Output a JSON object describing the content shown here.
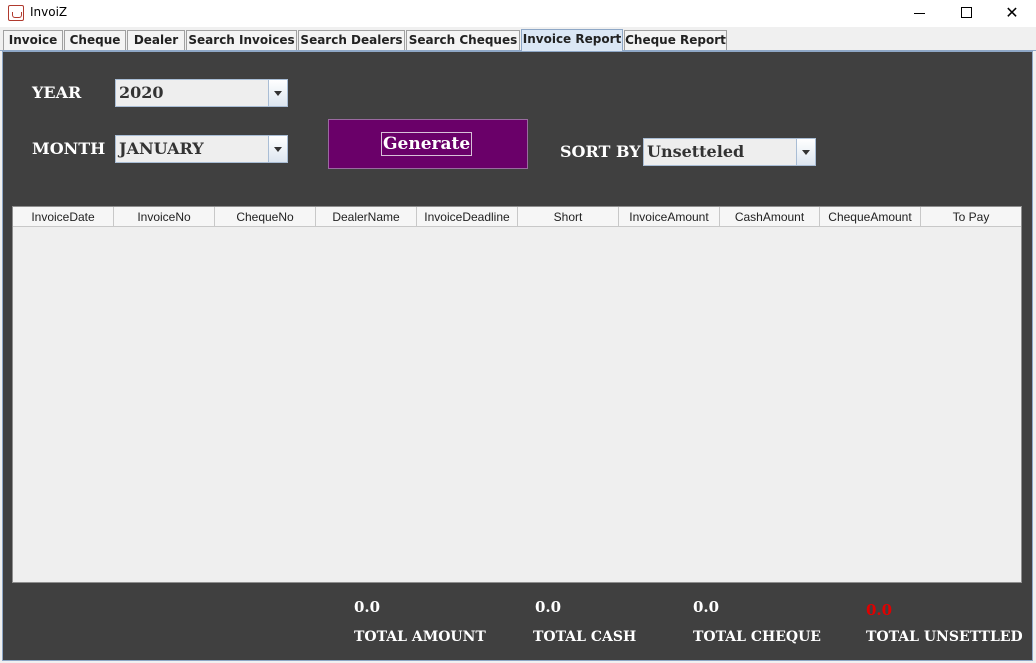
{
  "window": {
    "title": "InvoiZ",
    "minimize_icon": "minimize-icon",
    "maximize_icon": "maximize-icon",
    "close_icon": "close-icon"
  },
  "tabs": [
    {
      "label": "Invoice",
      "active": false
    },
    {
      "label": "Cheque",
      "active": false
    },
    {
      "label": "Dealer",
      "active": false
    },
    {
      "label": "Search Invoices",
      "active": false
    },
    {
      "label": "Search Dealers",
      "active": false
    },
    {
      "label": "Search Cheques",
      "active": false
    },
    {
      "label": "Invoice Report",
      "active": true
    },
    {
      "label": "Cheque Report",
      "active": false
    }
  ],
  "filters": {
    "year_label": "YEAR",
    "year_value": "2020",
    "month_label": "MONTH",
    "month_value": "JANUARY",
    "generate_label": "Generate",
    "sort_label": "SORT BY",
    "sort_value": "Unsetteled"
  },
  "table": {
    "columns": [
      "InvoiceDate",
      "InvoiceNo",
      "ChequeNo",
      "DealerName",
      "InvoiceDeadline",
      "Short",
      "InvoiceAmount",
      "CashAmount",
      "ChequeAmount",
      "To Pay"
    ],
    "rows": []
  },
  "totals": {
    "amount_value": "0.0",
    "amount_label": "TOTAL AMOUNT",
    "cash_value": "0.0",
    "cash_label": "TOTAL CASH",
    "cheque_value": "0.0",
    "cheque_label": "TOTAL CHEQUE",
    "unsettled_value": "0.0",
    "unsettled_label": "TOTAL UNSETTLED"
  },
  "colors": {
    "panel_bg": "#404040",
    "generate_bg": "#6a0069",
    "unsettled_value": "#e00000",
    "active_tab": "#dbe7f5"
  }
}
